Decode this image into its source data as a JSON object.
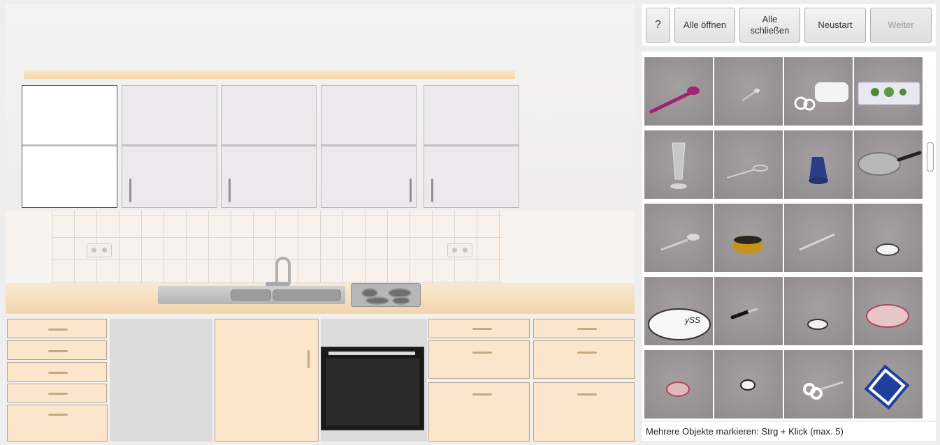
{
  "toolbar": {
    "help_label": "?",
    "open_all_label": "Alle öffnen",
    "close_all_label": "Alle schließen",
    "restart_label": "Neustart",
    "next_label": "Weiter"
  },
  "kitchen": {
    "upper_cabinets": [
      {
        "state": "open"
      },
      {
        "state": "closed",
        "handle": "left"
      },
      {
        "state": "closed",
        "handle": "left"
      },
      {
        "state": "closed",
        "handle": "right"
      },
      {
        "state": "closed",
        "handle": "left"
      }
    ]
  },
  "objects_panel": {
    "items": [
      {
        "icon": "pink-spoon-icon"
      },
      {
        "icon": "small-spoon-icon"
      },
      {
        "icon": "hand-mixer-icon"
      },
      {
        "icon": "herb-tray-icon"
      },
      {
        "icon": "glass-icon"
      },
      {
        "icon": "whisk-icon"
      },
      {
        "icon": "blue-jug-icon"
      },
      {
        "icon": "frying-pan-icon"
      },
      {
        "icon": "spoon-icon"
      },
      {
        "icon": "yellow-pot-icon"
      },
      {
        "icon": "knife-icon"
      },
      {
        "icon": "saucer-icon"
      },
      {
        "icon": "plate-icon",
        "label": "ySS"
      },
      {
        "icon": "peeler-icon"
      },
      {
        "icon": "small-saucer-icon"
      },
      {
        "icon": "red-bowl-icon"
      },
      {
        "icon": "small-bowl-icon"
      },
      {
        "icon": "cup-icon"
      },
      {
        "icon": "scissors-icon"
      },
      {
        "icon": "potholder-icon"
      }
    ]
  },
  "status": {
    "hint": "Mehrere Objekte markieren: Strg + Klick (max. 5)"
  }
}
